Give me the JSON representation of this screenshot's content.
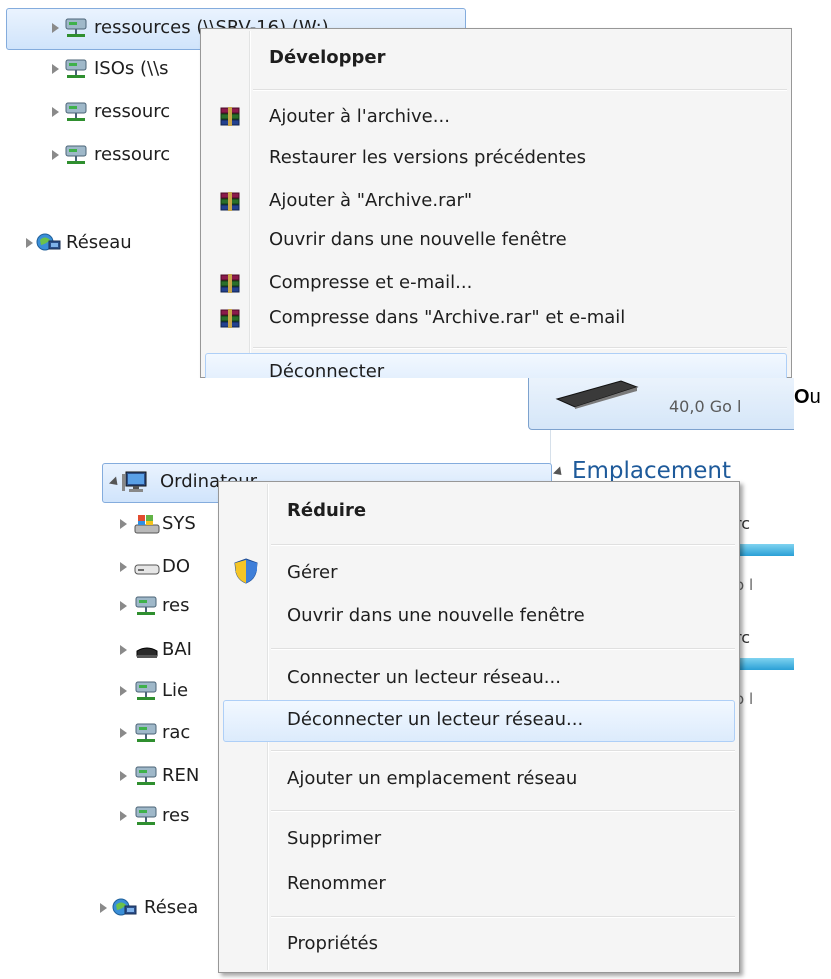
{
  "screenshot1": {
    "tree": [
      {
        "label": "ressources (\\\\SRV-16) (W:)",
        "icon": "network-drive-icon"
      },
      {
        "label": "ISOs (\\\\s",
        "icon": "network-drive-icon"
      },
      {
        "label": "ressourc",
        "icon": "network-drive-icon"
      },
      {
        "label": "ressourc",
        "icon": "network-drive-icon"
      },
      {
        "label": "Réseau",
        "icon": "network-icon"
      }
    ],
    "menu": [
      {
        "label": "Développer",
        "bold": true,
        "icon": ""
      },
      {
        "label": "Ajouter à l'archive...",
        "icon": "winrar-icon"
      },
      {
        "label": "Restaurer les versions précédentes",
        "icon": ""
      },
      {
        "label": "Ajouter à \"Archive.rar\"",
        "icon": "winrar-icon"
      },
      {
        "label": "Ouvrir dans une nouvelle fenêtre",
        "icon": ""
      },
      {
        "label": "Compresse et e-mail...",
        "icon": "winrar-icon"
      },
      {
        "label": "Compresse dans \"Archive.rar\" et e-mail",
        "icon": "winrar-icon"
      },
      {
        "label": "Déconnecter",
        "highlighted": true,
        "icon": ""
      }
    ]
  },
  "between_text": {
    "bold_part": "O",
    "rest": "u"
  },
  "screenshot2": {
    "right_panel": {
      "drive_size": "40,0 Go l",
      "section_title": "Emplacement",
      "frag_1": "rc",
      "frag_2": "o l",
      "frag_3": "rc",
      "frag_4": "o l"
    },
    "tree": [
      {
        "label": "Ordinateur",
        "icon": "computer-icon"
      },
      {
        "label": "SYS",
        "icon": "system-drive-icon"
      },
      {
        "label": "DO",
        "icon": "hard-drive-icon"
      },
      {
        "label": "res",
        "icon": "network-drive-icon"
      },
      {
        "label": "BAI",
        "icon": "removable-drive-icon"
      },
      {
        "label": "Lie",
        "icon": "network-drive-icon"
      },
      {
        "label": "rac",
        "icon": "network-drive-icon"
      },
      {
        "label": "REN",
        "icon": "network-drive-icon"
      },
      {
        "label": "res",
        "icon": "network-drive-icon"
      },
      {
        "label": "Résea",
        "icon": "network-icon"
      }
    ],
    "menu": [
      {
        "label": "Réduire",
        "bold": true,
        "icon": ""
      },
      {
        "label": "Gérer",
        "icon": "uac-shield-icon"
      },
      {
        "label": "Ouvrir dans une nouvelle fenêtre",
        "icon": ""
      },
      {
        "label": "Connecter un lecteur réseau...",
        "icon": ""
      },
      {
        "label": "Déconnecter un lecteur réseau...",
        "highlighted": true,
        "icon": ""
      },
      {
        "label": "Ajouter un emplacement réseau",
        "icon": ""
      },
      {
        "label": "Supprimer",
        "icon": ""
      },
      {
        "label": "Renommer",
        "icon": ""
      },
      {
        "label": "Propriétés",
        "icon": ""
      }
    ]
  },
  "colors": {
    "menu_bg": "#f5f5f5",
    "highlight_border": "#aecff7",
    "tree_selected": "#d9e9fb",
    "accent_blue": "#1e5a9a"
  }
}
